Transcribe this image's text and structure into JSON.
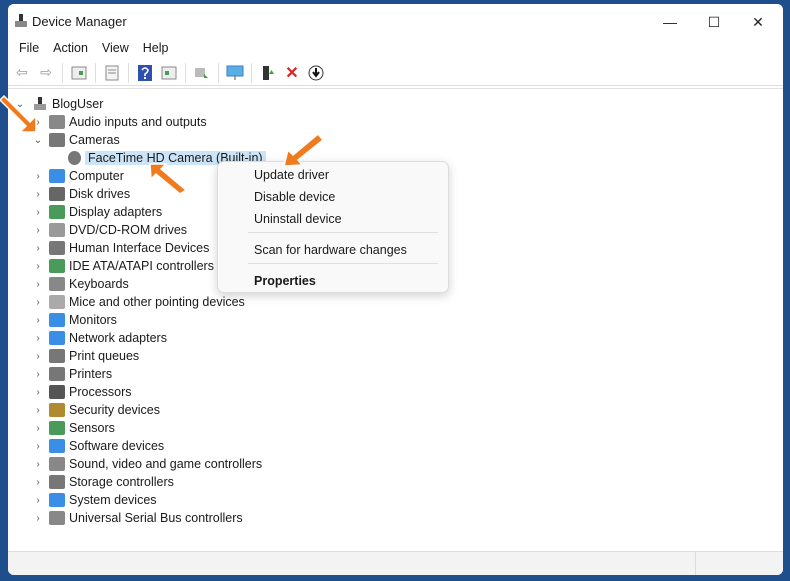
{
  "window": {
    "title": "Device Manager",
    "minimize": "—",
    "maximize": "☐",
    "close": "✕"
  },
  "menu": [
    "File",
    "Action",
    "View",
    "Help"
  ],
  "toolbar": [
    "back-icon",
    "forward-icon",
    "show-hide-console-tree-icon",
    "properties-icon",
    "help-icon",
    "action-pane-icon",
    "scan-hardware-icon",
    "monitor-icon",
    "update-driver-icon",
    "uninstall-icon",
    "disable-icon"
  ],
  "tree": {
    "root": "BlogUser",
    "categories": [
      {
        "label": "Audio inputs and outputs",
        "color": "#888"
      },
      {
        "label": "Cameras",
        "color": "#777",
        "expanded": true,
        "children": [
          "FaceTime HD Camera (Built-in)"
        ]
      },
      {
        "label": "Computer",
        "color": "#3a8ee6"
      },
      {
        "label": "Disk drives",
        "color": "#666"
      },
      {
        "label": "Display adapters",
        "color": "#4a9a5a"
      },
      {
        "label": "DVD/CD-ROM drives",
        "color": "#999"
      },
      {
        "label": "Human Interface Devices",
        "color": "#777"
      },
      {
        "label": "IDE ATA/ATAPI controllers",
        "color": "#4a9a5a"
      },
      {
        "label": "Keyboards",
        "color": "#888"
      },
      {
        "label": "Mice and other pointing devices",
        "color": "#aaa"
      },
      {
        "label": "Monitors",
        "color": "#3a8ee6"
      },
      {
        "label": "Network adapters",
        "color": "#3a8ee6"
      },
      {
        "label": "Print queues",
        "color": "#777"
      },
      {
        "label": "Printers",
        "color": "#777"
      },
      {
        "label": "Processors",
        "color": "#555"
      },
      {
        "label": "Security devices",
        "color": "#b08a30"
      },
      {
        "label": "Sensors",
        "color": "#4a9a5a"
      },
      {
        "label": "Software devices",
        "color": "#3a8ee6"
      },
      {
        "label": "Sound, video and game controllers",
        "color": "#888"
      },
      {
        "label": "Storage controllers",
        "color": "#777"
      },
      {
        "label": "System devices",
        "color": "#3a8ee6"
      },
      {
        "label": "Universal Serial Bus controllers",
        "color": "#888"
      }
    ]
  },
  "context_menu": {
    "items": [
      "Update driver",
      "Disable device",
      "Uninstall device",
      "Scan for hardware changes",
      "Properties"
    ]
  },
  "colors": {
    "accent": "#1f4e8c",
    "selection": "#cce4f7",
    "arrow": "#f07a1e"
  }
}
